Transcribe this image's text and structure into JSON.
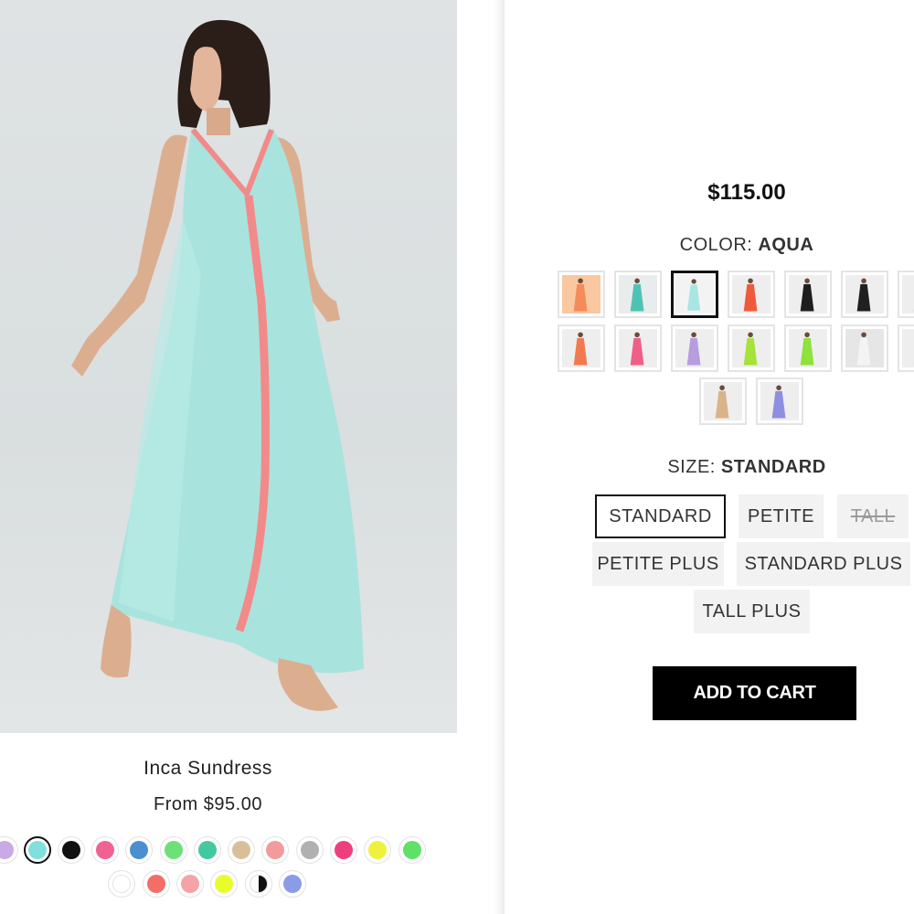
{
  "product_card": {
    "image_alt": "Model wearing aqua maxi dress with pink trim",
    "title": "Inca Sundress",
    "price": "From $95.00",
    "color_dots": [
      {
        "name": "lavender",
        "color": "#c9a9e6"
      },
      {
        "name": "aqua",
        "color": "#7fe0dc",
        "selected": true
      },
      {
        "name": "black",
        "color": "#111111"
      },
      {
        "name": "pink",
        "color": "#f06292"
      },
      {
        "name": "blue",
        "color": "#4a90d0"
      },
      {
        "name": "green",
        "color": "#6ee07a"
      },
      {
        "name": "teal",
        "color": "#43c9a0"
      },
      {
        "name": "tan",
        "color": "#d9bf99"
      },
      {
        "name": "coral pink",
        "color": "#f39a9a"
      },
      {
        "name": "grey",
        "color": "#b0b0b0"
      },
      {
        "name": "hot pink",
        "color": "#ef3e7e"
      },
      {
        "name": "yellow",
        "color": "#eef23c"
      },
      {
        "name": "bright green",
        "color": "#5fe066"
      },
      {
        "name": "white",
        "color": "#ffffff"
      },
      {
        "name": "coral",
        "color": "#f26e66"
      },
      {
        "name": "light pink",
        "color": "#f5a3a6"
      },
      {
        "name": "lime",
        "color": "#e8fb2d"
      },
      {
        "name": "black white",
        "color": "#111111"
      },
      {
        "name": "periwinkle",
        "color": "#8a9ce6"
      }
    ]
  },
  "quick_view": {
    "price": "$115.00",
    "color_label": "COLOR:",
    "color_value": "AQUA",
    "color_swatches": [
      {
        "name": "orange",
        "dress": "#f58a5a",
        "bg": "#f9c7a0"
      },
      {
        "name": "teal",
        "dress": "#4fc3b3",
        "bg": "#e9ecec"
      },
      {
        "name": "aqua",
        "dress": "#a8e6e2",
        "bg": "#f3f3f3",
        "selected": true
      },
      {
        "name": "red orange",
        "dress": "#ef5a3c",
        "bg": "#eeeeee"
      },
      {
        "name": "black trim",
        "dress": "#1e1e1e",
        "bg": "#eeeeee"
      },
      {
        "name": "black",
        "dress": "#202020",
        "bg": "#eeeeee"
      },
      {
        "name": "grey",
        "dress": "#d0d0d0",
        "bg": "#eeeeee"
      },
      {
        "name": "coral",
        "dress": "#f27a4e",
        "bg": "#eeeeee"
      },
      {
        "name": "pink",
        "dress": "#ef5f86",
        "bg": "#eeeeee"
      },
      {
        "name": "lilac",
        "dress": "#b79ce0",
        "bg": "#eeeeee"
      },
      {
        "name": "lime",
        "dress": "#a6e23a",
        "bg": "#eeeeee"
      },
      {
        "name": "neon green",
        "dress": "#8ee23c",
        "bg": "#eeeeee"
      },
      {
        "name": "white",
        "dress": "#f4f4f4",
        "bg": "#e6e6e6"
      },
      {
        "name": "light grey",
        "dress": "#dcdcdc",
        "bg": "#eeeeee"
      },
      {
        "name": "tan",
        "dress": "#d9b489",
        "bg": "#eeeeee"
      },
      {
        "name": "periwinkle",
        "dress": "#8f8fe0",
        "bg": "#eeeeee"
      }
    ],
    "size_label": "SIZE:",
    "size_value": "STANDARD",
    "sizes": [
      {
        "label": "STANDARD",
        "selected": true
      },
      {
        "label": "PETITE"
      },
      {
        "label": "TALL",
        "disabled": true
      },
      {
        "label": "PETITE PLUS"
      },
      {
        "label": "STANDARD PLUS"
      },
      {
        "label": "TALL PLUS"
      }
    ],
    "add_to_cart": "ADD TO CART"
  }
}
